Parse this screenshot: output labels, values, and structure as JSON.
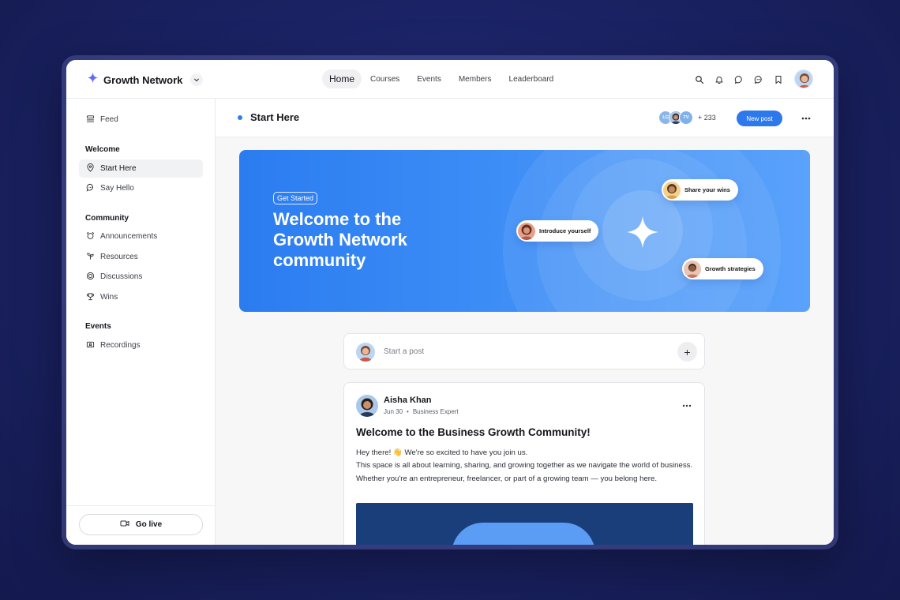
{
  "app": {
    "name": "Growth Network"
  },
  "nav": {
    "items": [
      "Home",
      "Courses",
      "Events",
      "Members",
      "Leaderboard"
    ],
    "active": "Home"
  },
  "top_icons": [
    "search-icon",
    "bell-icon",
    "chat-icon",
    "messages-icon",
    "bookmark-icon"
  ],
  "sidebar": {
    "feed": "Feed",
    "sections": [
      {
        "title": "Welcome",
        "items": [
          {
            "label": "Start Here",
            "icon": "map-pin-icon",
            "active": true
          },
          {
            "label": "Say Hello",
            "icon": "speech-bubble-icon"
          }
        ]
      },
      {
        "title": "Community",
        "items": [
          {
            "label": "Announcements",
            "icon": "alarm-icon"
          },
          {
            "label": "Resources",
            "icon": "sprout-icon"
          },
          {
            "label": "Discussions",
            "icon": "discussion-icon"
          },
          {
            "label": "Wins",
            "icon": "trophy-icon"
          }
        ]
      },
      {
        "title": "Events",
        "items": [
          {
            "label": "Recordings",
            "icon": "video-icon"
          }
        ]
      }
    ],
    "go_live": "Go live"
  },
  "header": {
    "title": "Start Here",
    "avatars": [
      "LC",
      "",
      "TV"
    ],
    "member_count": "+ 233",
    "new_post": "New post"
  },
  "hero": {
    "tag": "Get Started",
    "title": "Welcome to the Growth Network community",
    "pills": [
      "Share your wins",
      "Introduce yourself",
      "Growth strategies"
    ]
  },
  "composer": {
    "placeholder": "Start a post"
  },
  "post": {
    "author": "Aisha Khan",
    "date": "Jun 30",
    "role": "Business Expert",
    "title": "Welcome to the Business Growth Community!",
    "line1": "Hey there! 👋 We're so excited to have you join us.",
    "line2": "This space is all about learning, sharing, and growing together as we navigate the world of business. Whether you're an entrepreneur, freelancer, or part of a growing team — you belong here."
  },
  "colors": {
    "accent": "#2d79ec",
    "hero_start": "#2b7cf0",
    "hero_end": "#5aa2fb",
    "background": "#1b2366"
  }
}
